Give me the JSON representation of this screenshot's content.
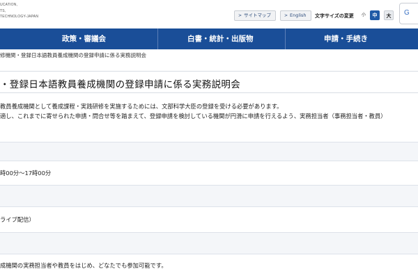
{
  "header": {
    "logo_lines": [
      "UCATION,",
      "TS,",
      "TECHNOLOGY-JAPAN"
    ],
    "sitemap_label": "サイトマップ",
    "english_label": "English",
    "font_size_label": "文字サイズの変更",
    "font_size_small": "小",
    "font_size_mid": "中",
    "font_size_large": "大",
    "search_letter": "G"
  },
  "nav": {
    "items": [
      {
        "label": "政策・審議会"
      },
      {
        "label": "白書・統計・出版物"
      },
      {
        "label": "申請・手続き"
      }
    ]
  },
  "breadcrumb": "修機関・登録日本語教員養成機関の登録申請に係る実務説明会",
  "page_title": "・登録日本語教員養成機関の登録申請に係る実務説明会",
  "intro": {
    "line1": "教員養成機関として養成課程・実践研修を実施するためには、文部科学大臣の登録を受ける必要があります。",
    "line2": "適し、これまでに寄せられた申請・問合せ等を踏まえて、登録申請を検討している機関が円滑に申請を行えるよう、実務担当者（事務担当者・教員）"
  },
  "details": {
    "time_text": "時00分～17時00分",
    "method_text": "ライブ配信）",
    "audience_text": "成機関の実務担当者や教員をはじめ、どなたでも参加可能です。"
  }
}
